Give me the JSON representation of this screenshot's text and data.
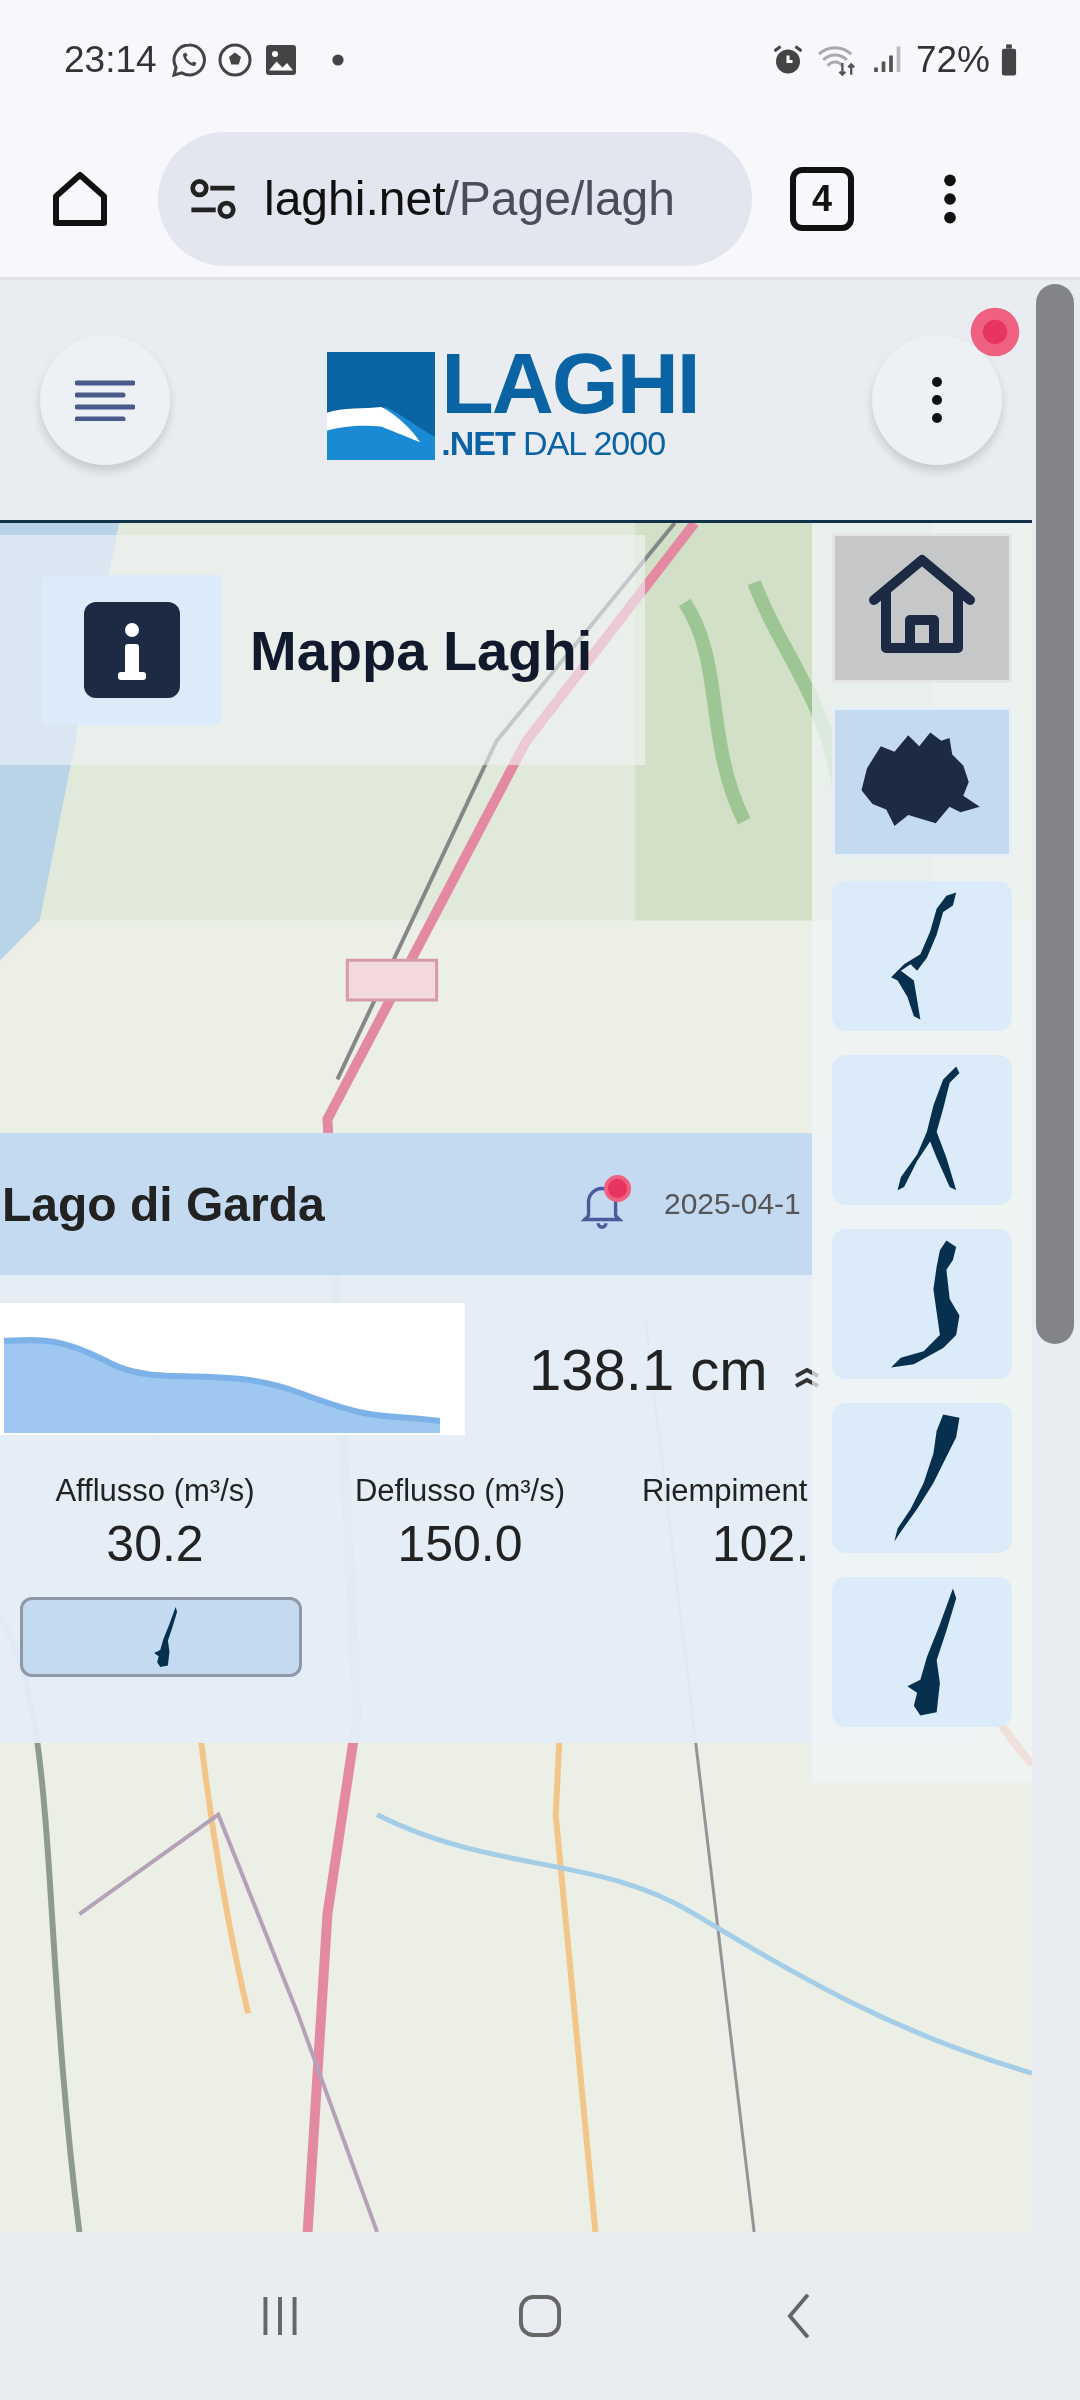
{
  "status_bar": {
    "time": "23:14",
    "battery": "72%"
  },
  "browser": {
    "url_host": "laghi.net",
    "url_path": "/Page/lagh",
    "tab_count": "4"
  },
  "header": {
    "logo_main": "LAGHI",
    "logo_net": ".NET",
    "logo_since": "DAL 2000",
    "menu_notification": true
  },
  "info_panel": {
    "title": "Mappa Laghi"
  },
  "lake_card": {
    "title": "Lago di Garda",
    "notification": true,
    "date": "2025-04-1",
    "level": "138.1 cm",
    "stats": [
      {
        "label": "Afflusso (m³/s)",
        "value": "30.2"
      },
      {
        "label": "Deflusso (m³/s)",
        "value": "150.0"
      },
      {
        "label": "Riempiment",
        "value": "102."
      }
    ]
  },
  "side_buttons": [
    {
      "kind": "home",
      "selected": false
    },
    {
      "kind": "region",
      "selected": true
    },
    {
      "kind": "lake",
      "selected": false
    },
    {
      "kind": "lake",
      "selected": false
    },
    {
      "kind": "lake",
      "selected": false
    },
    {
      "kind": "lake",
      "selected": false
    },
    {
      "kind": "lake",
      "selected": false
    }
  ]
}
